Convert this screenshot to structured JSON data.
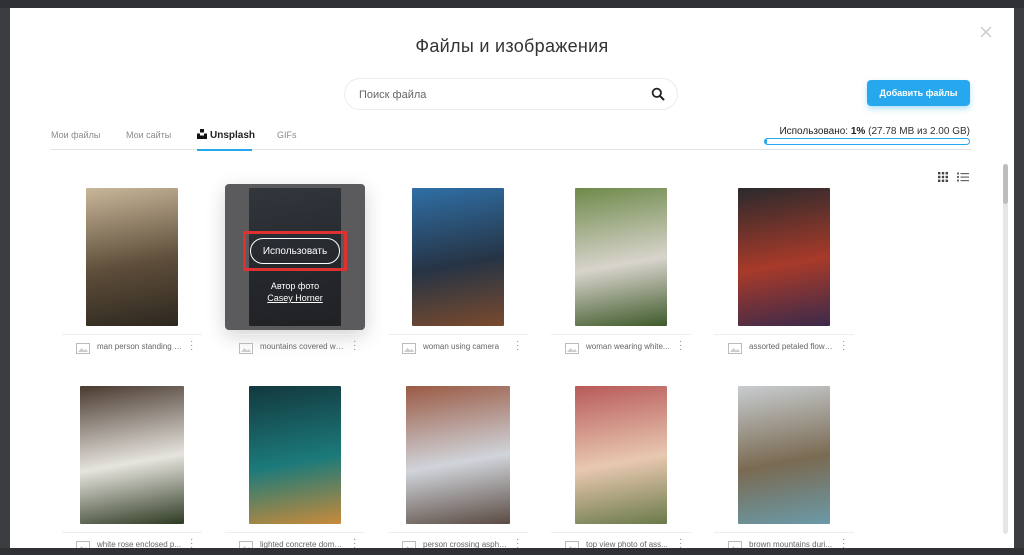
{
  "modal": {
    "title": "Файлы и изображения",
    "close_icon": "close-icon"
  },
  "search": {
    "placeholder": "Поиск файла",
    "icon": "search-icon"
  },
  "toolbar": {
    "add_files_label": "Добавить файлы"
  },
  "tabs": [
    {
      "label": "Мои файлы",
      "active": false
    },
    {
      "label": "Мои сайты",
      "active": false
    },
    {
      "label": "Unsplash",
      "active": true,
      "icon": "unsplash-logo-icon"
    },
    {
      "label": "GIFs",
      "active": false
    }
  ],
  "usage": {
    "label": "Использовано:",
    "percent_text": "1%",
    "detail": "(27.78 MB из 2.00 GB)",
    "fraction": 0.01,
    "accent": "#27a8ee"
  },
  "view": {
    "grid_icon": "grid-view-icon",
    "list_icon": "list-view-icon"
  },
  "hover_overlay": {
    "use_label": "Использовать",
    "author_label": "Автор фото",
    "author_name": "Casey Horner"
  },
  "images": [
    {
      "caption": "man person standing on...",
      "palette": [
        "#c9b79a",
        "#5e4e3a",
        "#2d271f"
      ]
    },
    {
      "caption": "mountains covered with...",
      "palette": [
        "#5b6d7a",
        "#2b3640",
        "#1b2026"
      ]
    },
    {
      "caption": "woman using camera",
      "palette": [
        "#2f6fa6",
        "#263445",
        "#7a4a2e"
      ]
    },
    {
      "caption": "woman wearing white...",
      "palette": [
        "#6e8a4a",
        "#d8d4cc",
        "#3f5a2a"
      ]
    },
    {
      "caption": "assorted petaled flowers...",
      "palette": [
        "#2a2a2c",
        "#a83a2a",
        "#3b2a4a"
      ]
    },
    {
      "caption": "white rose enclosed p...",
      "palette": [
        "#4a3a30",
        "#e6e4de",
        "#2e3a22"
      ]
    },
    {
      "caption": "lighted concrete dome...",
      "palette": [
        "#12383e",
        "#1c7a7a",
        "#c88a3a"
      ]
    },
    {
      "caption": "person crossing asphalt...",
      "palette": [
        "#9a5a44",
        "#d0d4da",
        "#5a4a42"
      ]
    },
    {
      "caption": "top view photo of ass...",
      "palette": [
        "#b85a5a",
        "#e8c8b0",
        "#6a7a4a"
      ]
    },
    {
      "caption": "brown mountains duri...",
      "palette": [
        "#c8cdd0",
        "#7a6a52",
        "#6a9aa8"
      ]
    }
  ]
}
